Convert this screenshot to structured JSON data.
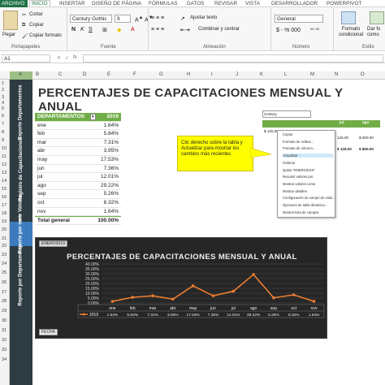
{
  "menu": {
    "file": "ARCHIVO",
    "tabs": [
      "INICIO",
      "INSERTAR",
      "DISEÑO DE PÁGINA",
      "FÓRMULAS",
      "DATOS",
      "REVISAR",
      "VISTA",
      "DESARROLLADOR",
      "POWERPIVOT"
    ],
    "active_tab": "INICIO"
  },
  "ribbon": {
    "paste": "Pegar",
    "cut": "Cortar",
    "copy": "Copiar",
    "format_painter": "Copiar formato",
    "clipboard_group": "Portapapeles",
    "font_name": "Century Gothic",
    "font_size": "9",
    "font_group": "Fuente",
    "wrap_text": "Ajustar texto",
    "merge_center": "Combinar y centrar",
    "alignment_group": "Alineación",
    "number_format": "General",
    "number_group": "Número",
    "cond_format": "Formato condicional",
    "format_table": "Dar fo como",
    "styles_group": "Estilo"
  },
  "formula_bar": {
    "cell_ref": "A1",
    "fx": "fx"
  },
  "columns": [
    "A",
    "B",
    "C",
    "D",
    "E",
    "F",
    "G",
    "H",
    "I",
    "J",
    "K",
    "L",
    "M",
    "N",
    "O"
  ],
  "rows": [
    "1",
    "2",
    "3",
    "4",
    "5",
    "6",
    "7",
    "8",
    "9",
    "10",
    "11",
    "12",
    "13",
    "14",
    "15",
    "16",
    "17",
    "18",
    "19",
    "20",
    "21",
    "22",
    "23",
    "24",
    "25",
    "26",
    "27",
    "28",
    "29",
    "30",
    "31",
    "32",
    "33",
    "34"
  ],
  "sidebar": [
    "Reporte Departamentos",
    "Registro de Capacitaciones",
    "Reporte Valores",
    "Reporte por mes",
    "Reporte por Departamento"
  ],
  "title": "PERCENTAJES DE CAPACITACIONES MENSUAL Y ANUAL",
  "pivot": {
    "header": [
      "DEPARTAMENTOS",
      "2019"
    ],
    "rows": [
      [
        "ene",
        "1.64%"
      ],
      [
        "feb",
        "5.84%"
      ],
      [
        "mar",
        "7.31%"
      ],
      [
        "abr",
        "3.95%"
      ],
      [
        "may",
        "17.53%"
      ],
      [
        "jun",
        "7.36%"
      ],
      [
        "jul",
        "12.01%"
      ],
      [
        "ago",
        "29.22%"
      ],
      [
        "sep",
        "5.26%"
      ],
      [
        "oct",
        "8.32%"
      ],
      [
        "nov",
        "1.64%"
      ]
    ],
    "total": [
      "Total general",
      "100.00%"
    ]
  },
  "callout": "Clic derecho sobre la tabla y Actualizar para mostrar los cambios más recientes",
  "context_menu": {
    "font": "Century",
    "items": [
      "Copiar",
      "Formato de celdas...",
      "Formato de número...",
      "Actualizar",
      "Ordenar",
      "Quitar \"ENERO2019\"",
      "Resumir valores por",
      "Mostrar valores como",
      "Mostrar detalles",
      "Configuración de campo de valor...",
      "Opciones de tabla dinámica...",
      "Mostrar lista de campos"
    ],
    "mini_values": [
      "$ 125.00",
      "126.00",
      "$ 126.00",
      "$ 800.00",
      "$ 800.00"
    ],
    "mini_headers": [
      "jul",
      "ago"
    ]
  },
  "chart_data": {
    "type": "line",
    "title": "PERCENTAJES DE CAPACITACIONES MENSUAL Y ANUAL",
    "filter_button": "ENERO2019",
    "legend": "2019",
    "footer_button": "FECHA",
    "categories": [
      "ene",
      "feb",
      "mar",
      "abr",
      "may",
      "jun",
      "jul",
      "ago",
      "sep",
      "oct",
      "nov"
    ],
    "values": [
      1.64,
      5.84,
      7.31,
      3.95,
      17.53,
      7.36,
      12.01,
      29.22,
      5.26,
      8.32,
      1.64
    ],
    "value_labels": [
      "1.64%",
      "5.84%",
      "7.31%",
      "3.95%",
      "17.53%",
      "7.36%",
      "12.01%",
      "29.22%",
      "5.26%",
      "8.32%",
      "1.64%"
    ],
    "y_ticks": [
      "0.00%",
      "5.00%",
      "10.00%",
      "15.00%",
      "20.00%",
      "25.00%",
      "30.00%",
      "35.00%",
      "40.00%"
    ],
    "ylim": [
      0,
      40
    ],
    "line_color": "#ed7d31"
  },
  "colors": {
    "excel_green": "#217346",
    "sidebar": "#2e3b42",
    "pivot_header": "#70ad47",
    "callout": "#ffff00"
  }
}
